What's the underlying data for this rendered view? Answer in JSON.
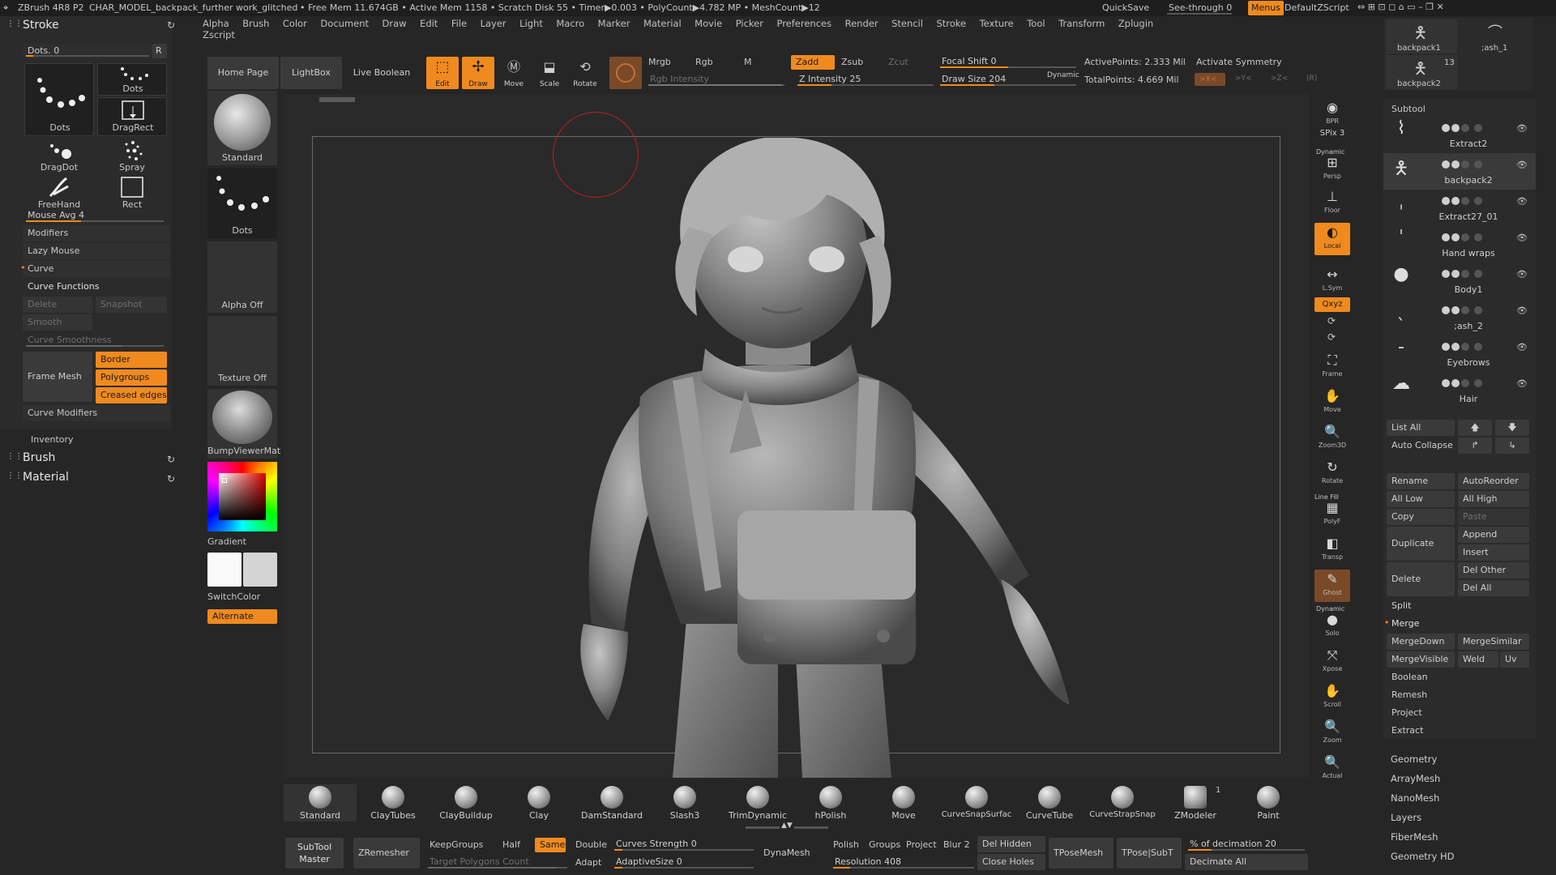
{
  "titlebar": {
    "app": "ZBrush 4R8 P2",
    "file": "CHAR_MODEL_backpack_further work_glitched",
    "stats": "• Free Mem 11.674GB • Active Mem 1158 • Scratch Disk 55 • Timer▶0.003 • PolyCount▶4.782 MP • MeshCount▶12",
    "quicksave": "QuickSave",
    "seethrough": "See-through  0",
    "menus": "Menus",
    "zscript": "DefaultZScript"
  },
  "menubar": [
    "Alpha",
    "Brush",
    "Color",
    "Document",
    "Draw",
    "Edit",
    "File",
    "Layer",
    "Light",
    "Macro",
    "Marker",
    "Material",
    "Movie",
    "Picker",
    "Preferences",
    "Render",
    "Stencil",
    "Stroke",
    "Texture",
    "Tool",
    "Transform",
    "Zplugin",
    "Zscript"
  ],
  "stroke_panel": {
    "title": "Stroke",
    "dots_slider": "Dots. 0",
    "r_btn": "R",
    "tiles": [
      "Dots",
      "Dots",
      "DragRect",
      "DragDot",
      "Spray",
      "FreeHand",
      "Rect"
    ],
    "mouse_avg": "Mouse Avg 4",
    "items": [
      "Modifiers",
      "Lazy Mouse",
      "Curve",
      "Curve Functions"
    ],
    "delete": "Delete",
    "snapshot": "Snapshot",
    "smooth": "Smooth",
    "curve_smoothness": "Curve Smoothness",
    "frame_mesh": "Frame Mesh",
    "border": "Border",
    "polygroups": "Polygroups",
    "creased": "Creased edges",
    "curve_modifiers": "Curve Modifiers",
    "inventory": "Inventory",
    "brush": "Brush",
    "material": "Material"
  },
  "top_shelf": {
    "home": "Home Page",
    "lightbox": "LightBox",
    "live_boolean": "Live Boolean",
    "edit": "Edit",
    "draw": "Draw",
    "move": "Move",
    "scale": "Scale",
    "rotate": "Rotate",
    "mrgb": "Mrgb",
    "rgb": "Rgb",
    "m": "M",
    "rgb_intensity": "Rgb Intensity",
    "zadd": "Zadd",
    "zsub": "Zsub",
    "zcut": "Zcut",
    "z_intensity": "Z Intensity 25",
    "focal_shift": "Focal Shift 0",
    "draw_size": "Draw Size 204",
    "dynamic": "Dynamic",
    "active_points": "ActivePoints: 2.333 Mil",
    "total_points": "TotalPoints: 4.669 Mil",
    "activate_symmetry": "Activate Symmetry",
    "sym_x": ">X<",
    "sym_y": ">Y<",
    "sym_z": ">Z<",
    "sym_r": "(R)",
    "z_intensity_value": 25,
    "draw_size_fraction": 0.2,
    "focal_shift_fraction": 0.5
  },
  "left_shelf": {
    "standard": "Standard",
    "dots": "Dots",
    "alpha_off": "Alpha Off",
    "texture_off": "Texture Off",
    "material": "BumpViewerMat",
    "gradient": "Gradient",
    "switch_color": "SwitchColor",
    "alternate": "Alternate"
  },
  "right_strip": [
    {
      "icon": "bpr",
      "label": "BPR"
    },
    {
      "icon": "spix",
      "label": "SPix 3"
    },
    {
      "icon": "persp",
      "label": "Persp"
    },
    {
      "icon": "floor",
      "label": "Floor"
    },
    {
      "icon": "local",
      "label": "Local"
    },
    {
      "icon": "lsym",
      "label": "L.Sym"
    },
    {
      "icon": "xyz",
      "label": "Qxyz"
    },
    {
      "icon": "frame",
      "label": "Frame"
    },
    {
      "icon": "move",
      "label": "Move"
    },
    {
      "icon": "zoom3d",
      "label": "Zoom3D"
    },
    {
      "icon": "rotate",
      "label": "Rotate"
    },
    {
      "icon": "polyf",
      "label": "PolyF"
    },
    {
      "icon": "transp",
      "label": "Transp"
    },
    {
      "icon": "ghost",
      "label": "Ghost"
    },
    {
      "icon": "solo",
      "label": "Solo"
    },
    {
      "icon": "xpose",
      "label": "Xpose"
    },
    {
      "icon": "scroll",
      "label": "Scroll"
    },
    {
      "icon": "zoom",
      "label": "Zoom"
    },
    {
      "icon": "actual",
      "label": "Actual"
    }
  ],
  "right_strip_extra": {
    "dynamic": "Dynamic",
    "line_fill": "Line Fill",
    "dynamic2": "Dynamic"
  },
  "tool_thumbs": {
    "t1": "backpack1",
    "t2": ";ash_1",
    "t3": "backpack2",
    "count": "13"
  },
  "subtool": {
    "title": "Subtool",
    "items": [
      "Extract2",
      "backpack2",
      "Extract27_01",
      "Hand wraps",
      "Body1",
      ";ash_2",
      "Eyebrows",
      "Hair"
    ],
    "list_all": "List All",
    "auto_collapse": "Auto Collapse",
    "rename": "Rename",
    "autoreorder": "AutoReorder",
    "all_low": "All Low",
    "all_high": "All High",
    "copy": "Copy",
    "paste": "Paste",
    "duplicate": "Duplicate",
    "append": "Append",
    "insert": "Insert",
    "delete": "Delete",
    "del_other": "Del Other",
    "del_all": "Del All",
    "split": "Split",
    "merge": "Merge",
    "mergedown": "MergeDown",
    "mergesimilar": "MergeSimilar",
    "mergevisible": "MergeVisible",
    "weld": "Weld",
    "uv": "Uv",
    "boolean": "Boolean",
    "remesh": "Remesh",
    "project": "Project",
    "extract": "Extract"
  },
  "palette_list": [
    "Geometry",
    "ArrayMesh",
    "NanoMesh",
    "Layers",
    "FiberMesh",
    "Geometry HD"
  ],
  "brushes": [
    "Standard",
    "ClayTubes",
    "ClayBuildup",
    "Clay",
    "DamStandard",
    "Slash3",
    "TrimDynamic",
    "hPolish",
    "Move",
    "CurveSnapSurfac",
    "CurveTube",
    "CurveStrapSnap",
    "ZModeler",
    "Paint"
  ],
  "zmodeler_count": "1",
  "bottom_tray": {
    "subtool_master": "SubTool Master",
    "zremesher": "ZRemesher",
    "keepgroups": "KeepGroups",
    "half": "Half",
    "same": "Same",
    "double": "Double",
    "target_polys": "Target Polygons Count",
    "adapt": "Adapt",
    "curves_strength": "Curves Strength 0",
    "adaptive_size": "AdaptiveSize 0",
    "dynamesh": "DynaMesh",
    "polish": "Polish",
    "groups": "Groups",
    "project": "Project",
    "blur": "Blur 2",
    "resolution": "Resolution 408",
    "del_hidden": "Del Hidden",
    "close_holes": "Close Holes",
    "tposemesh": "TPoseMesh",
    "tpose_subt": "TPose|SubT",
    "pct_decimation": "% of decimation 20",
    "decimate_all": "Decimate All"
  }
}
